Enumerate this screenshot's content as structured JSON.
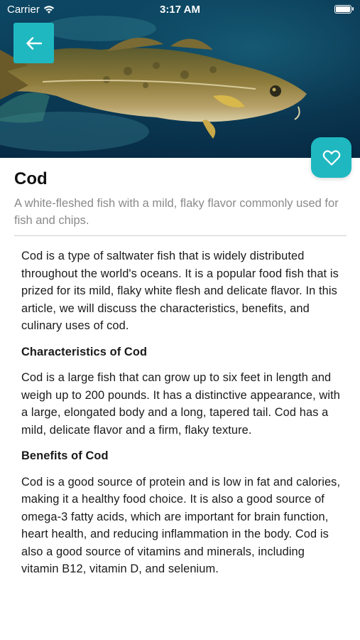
{
  "status_bar": {
    "carrier": "Carrier",
    "time": "3:17 AM"
  },
  "hero": {
    "alt": "Cod swimming underwater",
    "background_color": "#0c3c58"
  },
  "actions": {
    "back_icon": "arrow-left-icon",
    "favorite_icon": "heart-outline-icon",
    "accent_color": "#1fb8c1"
  },
  "fish": {
    "name": "Cod",
    "summary": "A white-fleshed fish with a mild, flaky flavor commonly used for fish and chips."
  },
  "article": {
    "intro": "Cod is a type of saltwater fish that is widely distributed throughout the world's oceans. It is a popular food fish that is prized for its mild, flaky white flesh and delicate flavor. In this article, we will discuss the characteristics, benefits, and culinary uses of cod.",
    "section1_heading": "Characteristics of Cod",
    "section1_body": "Cod is a large fish that can grow up to six feet in length and weigh up to 200 pounds. It has a distinctive appearance, with a large, elongated body and a long, tapered tail. Cod has a mild, delicate flavor and a firm, flaky texture.",
    "section2_heading": "Benefits of Cod",
    "section2_body": "Cod is a good source of protein and is low in fat and calories, making it a healthy food choice. It is also a good source of omega-3 fatty acids, which are important for brain function, heart health, and reducing inflammation in the body. Cod is also a good source of vitamins and minerals, including vitamin B12, vitamin D, and selenium."
  }
}
